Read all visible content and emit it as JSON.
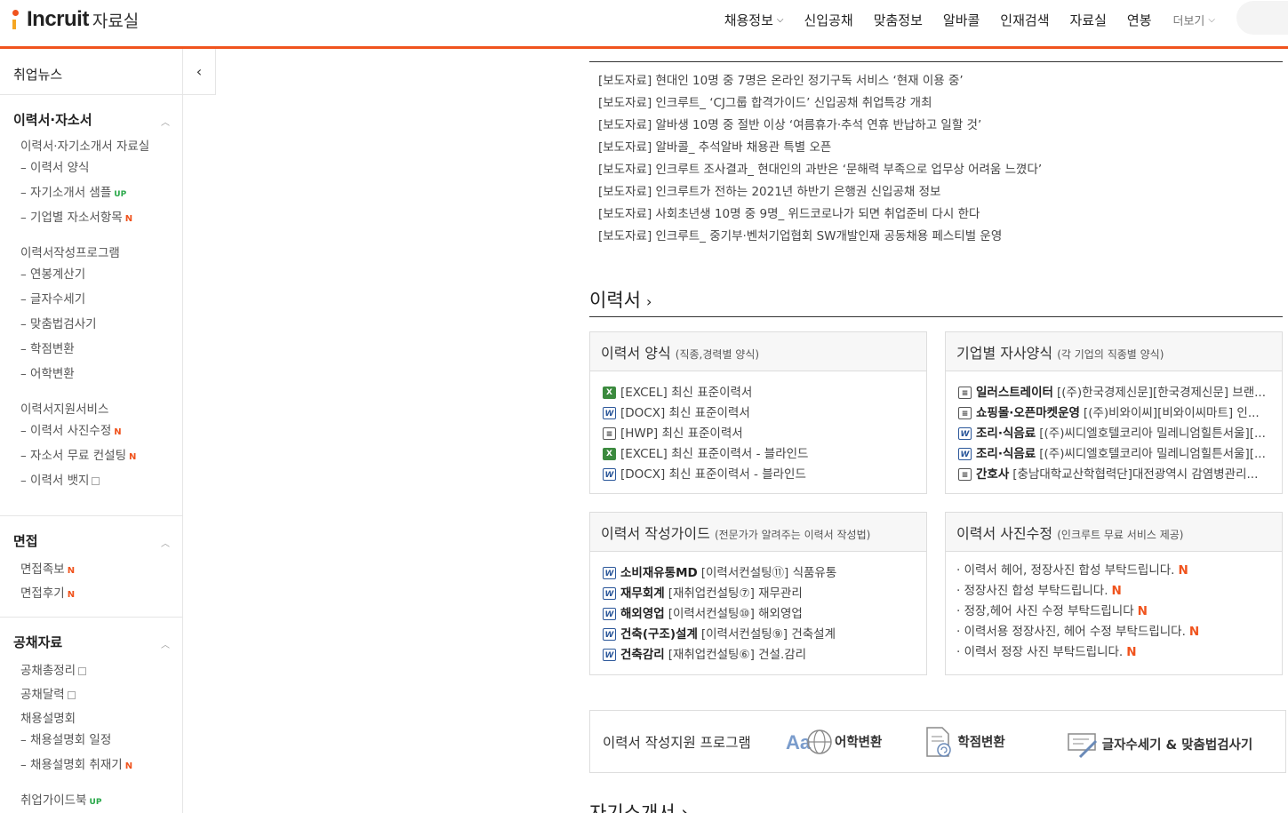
{
  "header": {
    "logo": "Incruit",
    "logo_sub": "자료실",
    "nav": [
      "채용정보",
      "신입공채",
      "맞춤정보",
      "알바콜",
      "인재검색",
      "자료실",
      "연봉"
    ],
    "more_label": "더보기",
    "accent_color": "#f0531d"
  },
  "sidebar": {
    "top_label": "취업뉴스",
    "toggle_icon": "‹",
    "groups": [
      {
        "title": "이력서·자소서",
        "items": [
          {
            "label": "이력서·자기소개서 자료실",
            "badge": ""
          },
          {
            "label": "– 이력서 양식",
            "badge": ""
          },
          {
            "label": "– 자기소개서 샘플",
            "badge": "UP"
          },
          {
            "label": "– 기업별 자소서항목",
            "badge": "N"
          },
          {
            "label": "이력서작성프로그램",
            "badge": ""
          },
          {
            "label": "– 연봉계산기",
            "badge": ""
          },
          {
            "label": "– 글자수세기",
            "badge": ""
          },
          {
            "label": "– 맞춤법검사기",
            "badge": ""
          },
          {
            "label": "– 학점변환",
            "badge": ""
          },
          {
            "label": "– 어학변환",
            "badge": ""
          },
          {
            "label": "이력서지원서비스",
            "badge": ""
          },
          {
            "label": "– 이력서 사진수정",
            "badge": "N"
          },
          {
            "label": "– 자소서 무료 컨설팅",
            "badge": "N"
          },
          {
            "label": "– 이력서 뱃지",
            "badge": "WIN"
          }
        ]
      },
      {
        "title": "면접",
        "items": [
          {
            "label": "면접족보",
            "badge": "N"
          },
          {
            "label": "면접후기",
            "badge": "N"
          }
        ]
      },
      {
        "title": "공채자료",
        "items": [
          {
            "label": "공채총정리",
            "badge": "WIN"
          },
          {
            "label": "공채달력",
            "badge": "WIN"
          },
          {
            "label": "채용설명회",
            "badge": ""
          },
          {
            "label": "– 채용설명회 일정",
            "badge": ""
          },
          {
            "label": "– 채용설명회 취재기",
            "badge": "N"
          },
          {
            "label": "취업가이드북",
            "badge": "UP"
          }
        ]
      }
    ]
  },
  "news": [
    "[보도자료] 현대인 10명 중 7명은 온라인 정기구독 서비스 ‘현재 이용 중’",
    "[보도자료] 인크루트_ ‘CJ그룹 합격가이드’ 신입공채 취업특강 개최",
    "[보도자료] 알바생 10명 중 절반 이상 ‘여름휴가·추석 연휴 반납하고 일할 것’",
    "[보도자료] 알바콜_ 추석알바 채용관 특별 오픈",
    "[보도자료] 인크루트 조사결과_ 현대인의 과반은 ‘문해력 부족으로 업무상 어려움 느꼈다’",
    "[보도자료] 인크루트가 전하는 2021년 하반기 은행권 신입공채 정보",
    "[보도자료] 사회초년생 10명 중 9명_ 위드코로나가 되면 취업준비 다시 한다",
    "[보도자료] 인크루트_ 중기부·벤처기업협회 SW개발인재 공동채용 페스티벌 운영"
  ],
  "resume_section": {
    "title": "이력서",
    "arrow": "›",
    "boxes": {
      "forms": {
        "title": "이력서 양식",
        "subtitle": "(직종,경력별 양식)",
        "rows": [
          {
            "icon": "xls",
            "text": "[EXCEL] 최신 표준이력서"
          },
          {
            "icon": "doc",
            "text": "[DOCX] 최신 표준이력서"
          },
          {
            "icon": "hwp",
            "text": "[HWP] 최신 표준이력서"
          },
          {
            "icon": "xls",
            "text": "[EXCEL] 최신 표준이력서 - 블라인드"
          },
          {
            "icon": "doc",
            "text": "[DOCX] 최신 표준이력서 - 블라인드"
          }
        ]
      },
      "company": {
        "title": "기업별 자사양식",
        "subtitle": "(각 기업의 직종별 양식)",
        "rows": [
          {
            "icon": "hwp",
            "bold": "일러스트레이터",
            "text": "[(주)한국경제신문][한국경제신문] 브랜..."
          },
          {
            "icon": "hwp",
            "bold": "쇼핑몰·오픈마켓운영",
            "text": "[(주)비와이씨][비와이씨마트] 인..."
          },
          {
            "icon": "doc",
            "bold": "조리·식음료",
            "text": "[(주)씨디엘호텔코리아 밀레니엄힐튼서울][..."
          },
          {
            "icon": "doc",
            "bold": "조리·식음료",
            "text": "[(주)씨디엘호텔코리아 밀레니엄힐튼서울][..."
          },
          {
            "icon": "hwp",
            "bold": "간호사",
            "text": "[충남대학교산학협력단]대전광역시 감염병관리..."
          }
        ]
      },
      "guide": {
        "title": "이력서 작성가이드",
        "subtitle": "(전문가가 알려주는 이력서 작성법)",
        "rows": [
          {
            "icon": "doc",
            "bold": "소비재유통MD",
            "text": "[이력서컨설팅⑪] 식품유통"
          },
          {
            "icon": "doc",
            "bold": "재무회계",
            "text": "[재취업컨설팅⑦] 재무관리"
          },
          {
            "icon": "doc",
            "bold": "해외영업",
            "text": "[이력서컨설팅⑩] 해외영업"
          },
          {
            "icon": "doc",
            "bold": "건축(구조)설계",
            "text": "[이력서컨설팅⑨] 건축설계"
          },
          {
            "icon": "doc",
            "bold": "건축감리",
            "text": "[재취업컨설팅⑥] 건설.감리"
          }
        ]
      },
      "photo": {
        "title": "이력서 사진수정",
        "subtitle": "(인크루트 무료 서비스 제공)",
        "rows": [
          "· 이력서 헤어, 정장사진 합성 부탁드립니다.",
          "· 정장사진 합성 부탁드립니다.",
          "· 정장,헤어 사진 수정 부탁드립니다",
          "· 이력서용 정장사진, 헤어 수정 부탁드립니다.",
          "· 이력서 정장 사진 부탁드립니다."
        ],
        "badge": "N"
      }
    }
  },
  "program_bar": {
    "title": "이력서 작성지원 프로그램",
    "items": [
      {
        "icon": "language-icon",
        "label": "어학변환"
      },
      {
        "icon": "grade-icon",
        "label": "학점변환"
      },
      {
        "icon": "spellcheck-icon",
        "label": "글자수세기 & 맞춤법검사기"
      }
    ]
  },
  "next_section_title": "자기소개서 ›"
}
